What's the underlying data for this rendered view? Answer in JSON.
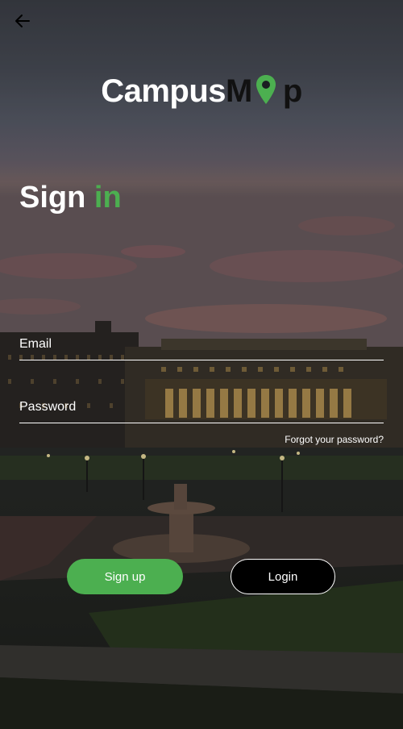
{
  "header": {
    "back_icon": "arrow-left-icon"
  },
  "logo": {
    "part1": "Campus",
    "part2": "M",
    "pin_icon": "map-pin-icon",
    "part3": "p",
    "pin_color": "#4caf50"
  },
  "title": {
    "word1": "Sign",
    "word2": "in"
  },
  "form": {
    "email_label": "Email",
    "email_value": "",
    "password_label": "Password",
    "password_value": "",
    "forgot_label": "Forgot your password?"
  },
  "buttons": {
    "signup_label": "Sign up",
    "login_label": "Login"
  },
  "colors": {
    "accent": "#4caf50",
    "login_bg": "#000000"
  },
  "background": {
    "scene": "campus-evening-photo"
  }
}
